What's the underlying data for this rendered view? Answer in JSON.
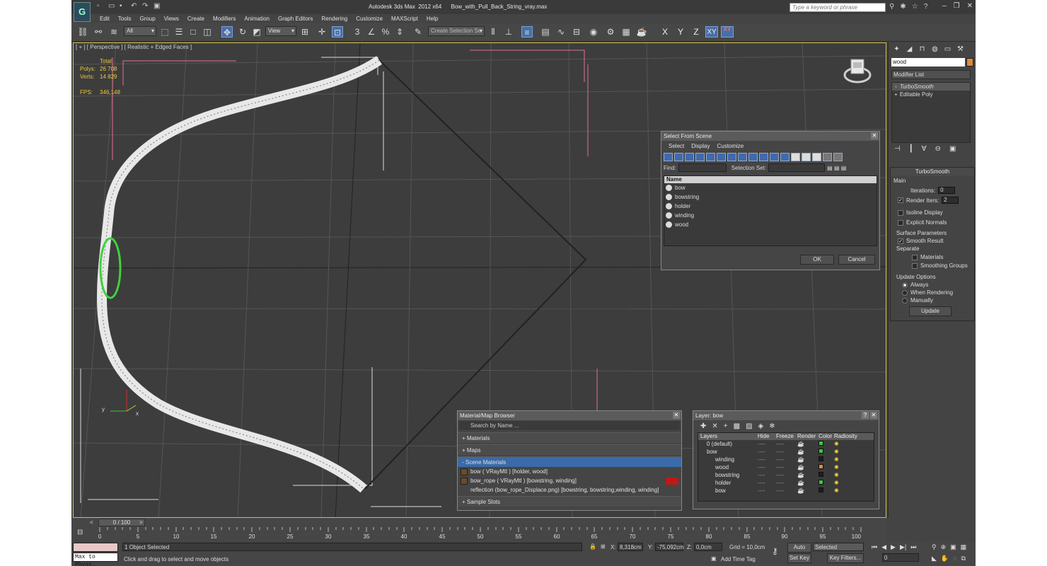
{
  "app": {
    "title": "Autodesk 3ds Max  2012 x64      Bow_with_Pull_Back_String_vray.max",
    "search_placeholder": "Type a keyword or phrase",
    "menus": [
      "Edit",
      "Tools",
      "Group",
      "Views",
      "Create",
      "Modifiers",
      "Animation",
      "Graph Editors",
      "Rendering",
      "Customize",
      "MAXScript",
      "Help"
    ]
  },
  "toolbar": {
    "filter_value": "All",
    "refcoord_value": "View",
    "named_selection_placeholder": "Create Selection Se",
    "axis_x": "X",
    "axis_y": "Y",
    "axis_z": "Z",
    "axis_xy": "XY",
    "axis_xy2": "XY"
  },
  "viewport": {
    "label": "[ + ] [ Perspective ] [ Realistic + Edged Faces ]",
    "stats": {
      "header": "Total",
      "polys_label": "Polys:",
      "polys_value": "26 708",
      "verts_label": "Verts:",
      "verts_value": "14 829",
      "fps_label": "FPS:",
      "fps_value": "346,148"
    },
    "axis_label_y": "y",
    "axis_label_x": "x"
  },
  "select_from_scene": {
    "title": "Select From Scene",
    "menus": [
      "Select",
      "Display",
      "Customize"
    ],
    "find_label": "Find:",
    "selection_set_label": "Selection Set:",
    "column_name": "Name",
    "items": [
      "bow",
      "bowstring",
      "holder",
      "winding",
      "wood"
    ],
    "ok_label": "OK",
    "cancel_label": "Cancel"
  },
  "material_browser": {
    "title": "Material/Map Browser",
    "search_placeholder": "Search by Name ...",
    "sections": {
      "materials": "+ Materials",
      "maps": "+ Maps",
      "scene_materials": "- Scene Materials",
      "sample_slots": "+ Sample Slots"
    },
    "scene_items": [
      "bow  ( VRayMtl )  [holder, wood]",
      "bow_rope  ( VRayMtl )  [bowstring, winding]",
      "reflection (bow_rope_Displace.png) [bowstring, bowstring,winding, winding]"
    ]
  },
  "layer_dialog": {
    "title": "Layer: bow",
    "help": "?",
    "columns": [
      "Layers",
      "Hide",
      "Freeze",
      "Render",
      "Color",
      "Radiosity"
    ],
    "rows": [
      {
        "name": "0 (default)",
        "color": "#3cc83c"
      },
      {
        "name": "bow",
        "color": "#3cc83c"
      },
      {
        "name": "winding",
        "color": "#1e1e1e"
      },
      {
        "name": "wood",
        "color": "#e0883a"
      },
      {
        "name": "bowstring",
        "color": "#1e1e1e"
      },
      {
        "name": "holder",
        "color": "#3cc83c"
      },
      {
        "name": "bow",
        "color": "#1e1e1e"
      }
    ],
    "dash": "----"
  },
  "command_panel": {
    "object_name": "wood",
    "object_color": "#e0883a",
    "modifier_list_label": "Modifier List",
    "stack": [
      "TurboSmooth",
      "Editable Poly"
    ],
    "turbosmooth": {
      "title": "TurboSmooth",
      "main_label": "Main",
      "iterations_label": "Iterations:",
      "iterations_value": "0",
      "render_iters_label": "Render Iters:",
      "render_iters_value": "2",
      "isoline_label": "Isoline Display",
      "explicit_normals_label": "Explicit Normals",
      "surface_params_label": "Surface Parameters",
      "smooth_result_label": "Smooth Result",
      "separate_label": "Separate",
      "materials_label": "Materials",
      "smoothing_groups_label": "Smoothing Groups",
      "update_options_label": "Update Options",
      "always_label": "Always",
      "when_rendering_label": "When Rendering",
      "manually_label": "Manually",
      "update_button": "Update"
    }
  },
  "timeline": {
    "frame_display": "0 / 100",
    "ticks": [
      "0",
      "5",
      "10",
      "15",
      "20",
      "25",
      "30",
      "35",
      "40",
      "45",
      "50",
      "55",
      "60",
      "65",
      "70",
      "75",
      "80",
      "85",
      "90",
      "95",
      "100"
    ]
  },
  "status": {
    "maxscript_label": "Max to Physc.",
    "selection_status": "1 Object Selected",
    "prompt": "Click and drag to select and move objects",
    "x_label": "X:",
    "x_value": "8,318cm",
    "y_label": "Y:",
    "y_value": "-75,092cm",
    "z_label": "Z:",
    "z_value": "0,0cm",
    "grid": "Grid = 10,0cm",
    "add_time_tag": "Add Time Tag",
    "auto_key": "Auto Key",
    "set_key": "Set Key",
    "selected_value": "Selected",
    "key_filters": "Key Filters...",
    "frame_value": "0"
  }
}
